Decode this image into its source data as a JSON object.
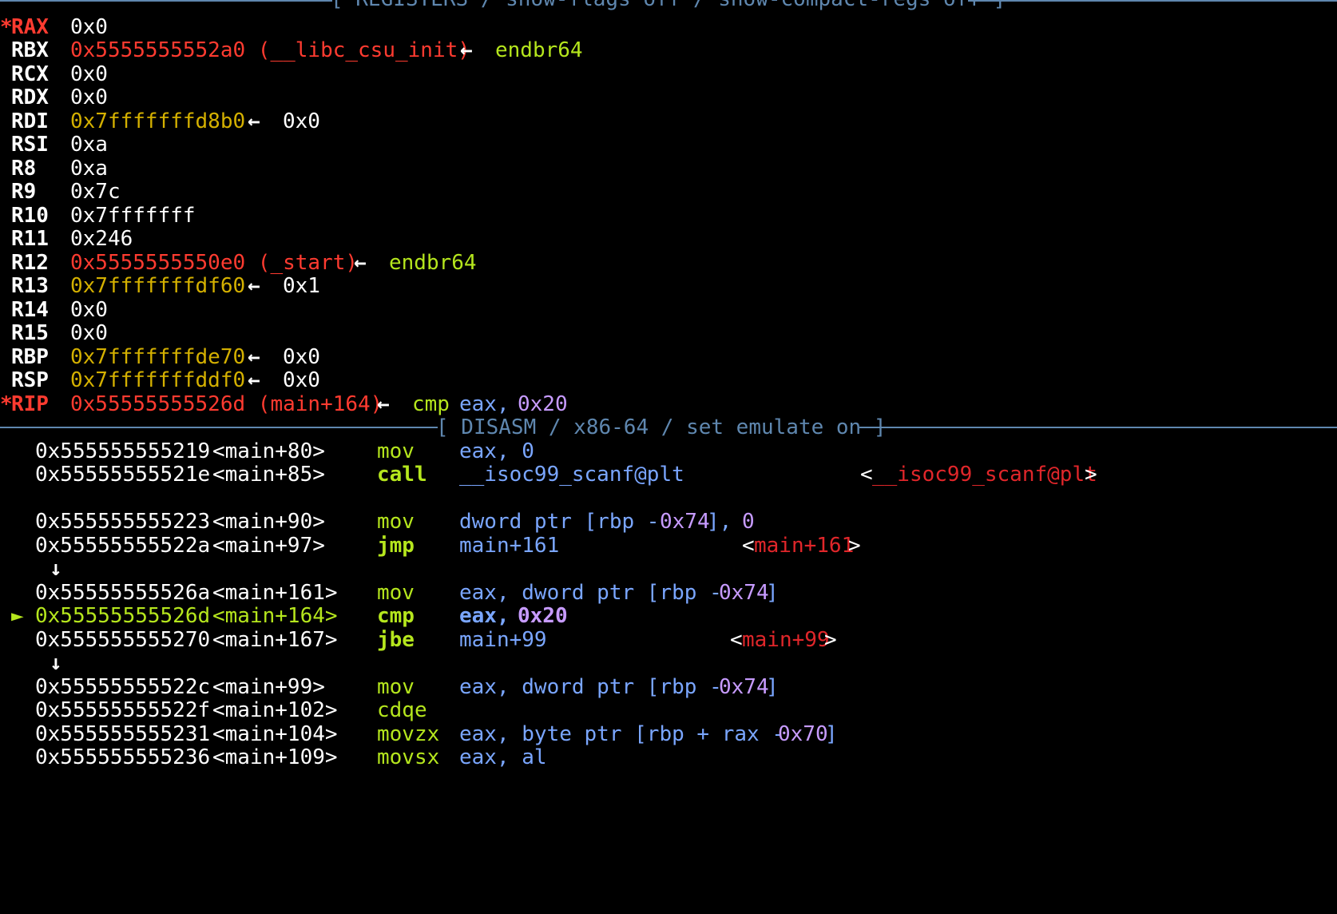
{
  "banners": {
    "registers": "[ REGISTERS / show-flags off / show-compact-regs off ]",
    "disasm": "[ DISASM / x86-64 / set emulate on ]"
  },
  "colors": {
    "accent": "#5f87af",
    "changed_register": "#ff3b30",
    "code_pointer": "#ff3b30",
    "stack_pointer": "#d4b000",
    "instruction": "#b5e61d",
    "operand": "#7aa6ff",
    "immediate": "#c79bff"
  },
  "registers": [
    {
      "marker": "*",
      "name": "RAX",
      "value": "0x0"
    },
    {
      "marker": "",
      "name": "RBX",
      "value": "0x5555555552a0 (__libc_csu_init)",
      "arrow": "←",
      "target": "endbr64"
    },
    {
      "marker": "",
      "name": "RCX",
      "value": "0x0"
    },
    {
      "marker": "",
      "name": "RDX",
      "value": "0x0"
    },
    {
      "marker": "",
      "name": "RDI",
      "value": "0x7fffffffd8b0",
      "arrow": "←",
      "target": "0x0"
    },
    {
      "marker": "",
      "name": "RSI",
      "value": "0xa"
    },
    {
      "marker": "",
      "name": "R8",
      "value": "0xa"
    },
    {
      "marker": "",
      "name": "R9",
      "value": "0x7c"
    },
    {
      "marker": "",
      "name": "R10",
      "value": "0x7fffffff"
    },
    {
      "marker": "",
      "name": "R11",
      "value": "0x246"
    },
    {
      "marker": "",
      "name": "R12",
      "value": "0x5555555550e0 (_start)",
      "arrow": "←",
      "target": "endbr64"
    },
    {
      "marker": "",
      "name": "R13",
      "value": "0x7fffffffdf60",
      "arrow": "←",
      "target": "0x1"
    },
    {
      "marker": "",
      "name": "R14",
      "value": "0x0"
    },
    {
      "marker": "",
      "name": "R15",
      "value": "0x0"
    },
    {
      "marker": "",
      "name": "RBP",
      "value": "0x7fffffffde70",
      "arrow": "←",
      "target": "0x0"
    },
    {
      "marker": "",
      "name": "RSP",
      "value": "0x7fffffffddf0",
      "arrow": "←",
      "target": "0x0"
    },
    {
      "marker": "*",
      "name": "RIP",
      "value": "0x55555555526d (main+164)",
      "arrow": "←",
      "target_op": "cmp",
      "target_args_a": "eax,",
      "target_args_b": "0x20"
    }
  ],
  "disasm": [
    {
      "addr": "0x555555555219",
      "sym": "<main+80>",
      "op": "mov",
      "args": "eax, 0"
    },
    {
      "addr": "0x55555555521e",
      "sym": "<main+85>",
      "op": "call",
      "args": "__isoc99_scanf@plt",
      "ref_open": "<",
      "ref": "__isoc99_scanf@plt",
      "ref_close": ">"
    },
    {
      "addr": "0x555555555223",
      "sym": "<main+90>",
      "op": "mov",
      "args_a": "dword ptr [rbp - ",
      "args_b": "0x74",
      "args_c": "], ",
      "args_d": "0"
    },
    {
      "addr": "0x55555555522a",
      "sym": "<main+97>",
      "op": "jmp",
      "args": "main+161",
      "ref_open": "<",
      "ref": "main+161",
      "ref_close": ">"
    },
    {
      "jump_arrow": "↓"
    },
    {
      "addr": "0x55555555526a",
      "sym": "<main+161>",
      "op": "mov",
      "args_a": "eax, dword ptr [rbp - ",
      "args_b": "0x74",
      "args_c": "]"
    },
    {
      "current": true,
      "marker": "►",
      "addr": "0x55555555526d",
      "sym": "<main+164>",
      "op": "cmp",
      "args_a": "eax, ",
      "args_b": "0x20"
    },
    {
      "addr": "0x555555555270",
      "sym": "<main+167>",
      "op": "jbe",
      "args": "main+99",
      "ref_open": "<",
      "ref": "main+99",
      "ref_close": ">"
    },
    {
      "jump_arrow": "↓"
    },
    {
      "addr": "0x55555555522c",
      "sym": "<main+99>",
      "op": "mov",
      "args_a": "eax, dword ptr [rbp - ",
      "args_b": "0x74",
      "args_c": "]"
    },
    {
      "addr": "0x55555555522f",
      "sym": "<main+102>",
      "op": "cdqe"
    },
    {
      "addr": "0x555555555231",
      "sym": "<main+104>",
      "op": "movzx",
      "args_a": "eax, byte ptr [rbp + rax - ",
      "args_b": "0x70",
      "args_c": "]"
    },
    {
      "addr": "0x555555555236",
      "sym": "<main+109>",
      "op": "movsx",
      "args": "eax, al"
    }
  ]
}
